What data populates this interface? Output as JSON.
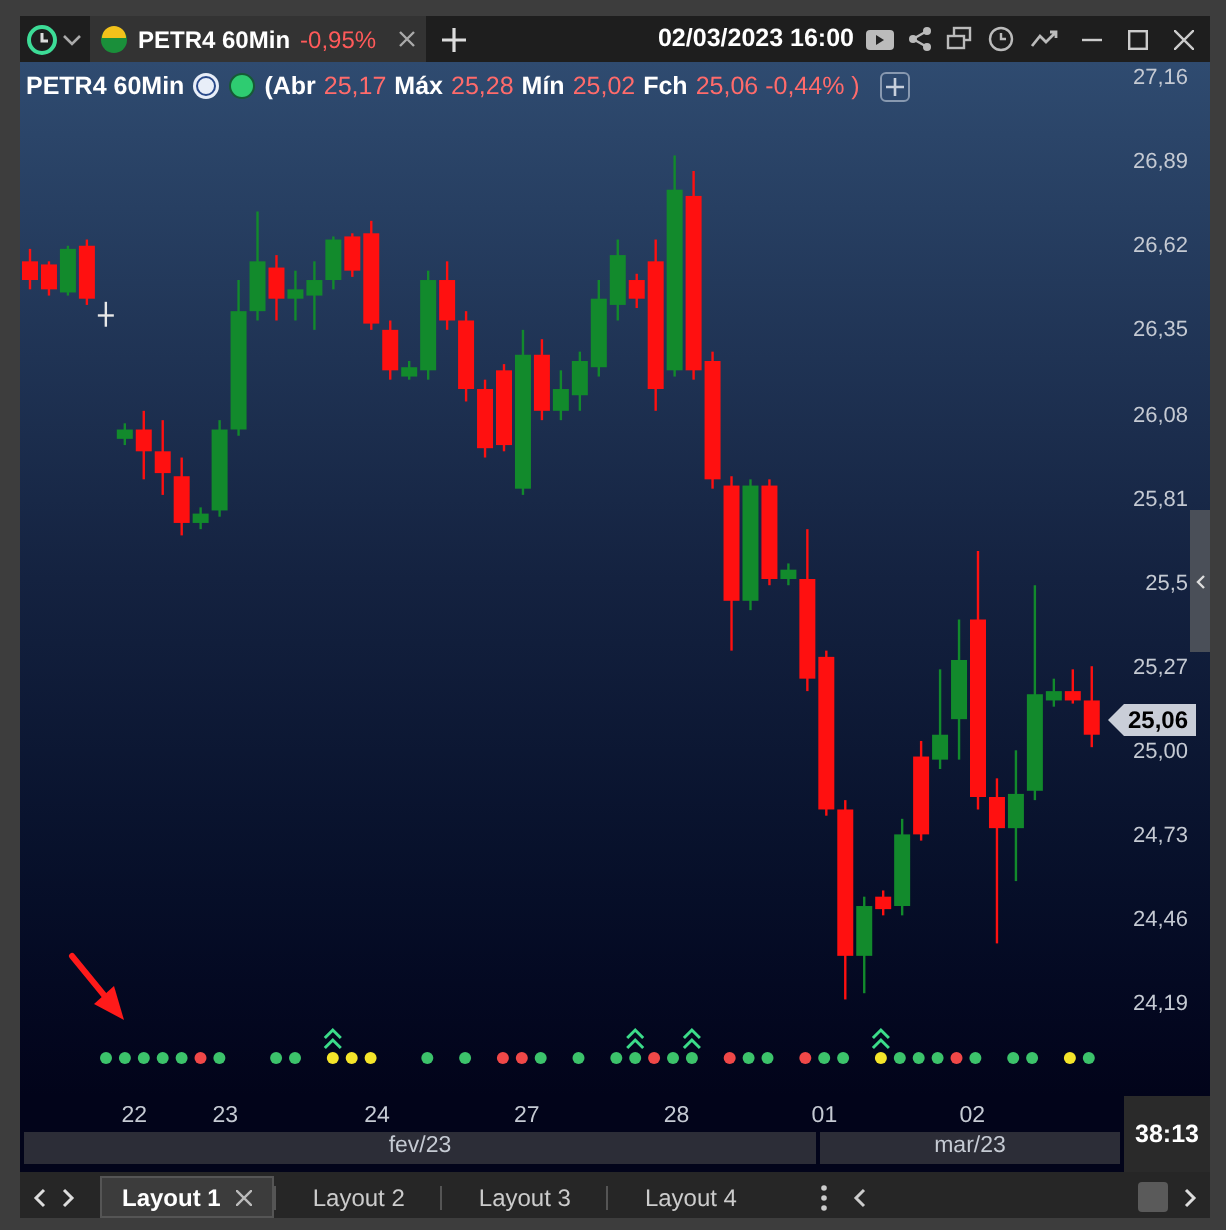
{
  "title_bar": {
    "tab": {
      "symbol": "PETR4 60Min",
      "change": "-0,95%"
    },
    "datetime": "02/03/2023 16:00"
  },
  "header": {
    "symbol": "PETR4 60Min",
    "fields": [
      {
        "label": "(Abr",
        "value": "25,17"
      },
      {
        "label": "Máx",
        "value": "25,28"
      },
      {
        "label": "Mín",
        "value": "25,02"
      },
      {
        "label": "Fch",
        "value": "25,06 -0,44% )"
      }
    ]
  },
  "chart": {
    "chart_data": {
      "type": "candlestick",
      "categories": [
        null,
        null,
        null,
        null,
        null,
        null,
        null,
        null,
        null,
        null,
        null,
        null,
        null,
        null,
        null,
        null,
        null,
        null,
        null,
        null,
        null,
        null,
        null,
        null,
        null,
        null,
        null,
        null,
        null,
        null,
        null,
        null,
        null,
        null,
        null,
        null,
        null,
        null,
        null,
        null,
        null,
        null,
        null,
        null,
        null,
        null,
        null,
        null,
        null,
        null,
        null,
        null,
        null,
        null,
        null,
        null,
        null
      ],
      "ohlc": [
        [
          26.58,
          26.62,
          26.49,
          26.52
        ],
        [
          26.57,
          26.58,
          26.47,
          26.49
        ],
        [
          26.48,
          26.63,
          26.47,
          26.62
        ],
        [
          26.63,
          26.65,
          26.44,
          26.46
        ],
        [
          26.41,
          26.45,
          26.37,
          26.41
        ],
        [
          26.01,
          26.06,
          25.99,
          26.04
        ],
        [
          26.04,
          26.1,
          25.88,
          25.97
        ],
        [
          25.97,
          26.07,
          25.83,
          25.9
        ],
        [
          25.89,
          25.95,
          25.7,
          25.74
        ],
        [
          25.74,
          25.79,
          25.72,
          25.77
        ],
        [
          25.78,
          26.07,
          25.76,
          26.04
        ],
        [
          26.04,
          26.52,
          26.02,
          26.42
        ],
        [
          26.42,
          26.74,
          26.39,
          26.58
        ],
        [
          26.56,
          26.6,
          26.39,
          26.46
        ],
        [
          26.46,
          26.55,
          26.39,
          26.49
        ],
        [
          26.47,
          26.58,
          26.36,
          26.52
        ],
        [
          26.52,
          26.66,
          26.49,
          26.65
        ],
        [
          26.66,
          26.67,
          26.53,
          26.55
        ],
        [
          26.67,
          26.71,
          26.36,
          26.38
        ],
        [
          26.36,
          26.39,
          26.2,
          26.23
        ],
        [
          26.21,
          26.26,
          26.2,
          26.24
        ],
        [
          26.23,
          26.55,
          26.2,
          26.52
        ],
        [
          26.52,
          26.58,
          26.36,
          26.39
        ],
        [
          26.39,
          26.42,
          26.13,
          26.17
        ],
        [
          26.17,
          26.2,
          25.95,
          25.98
        ],
        [
          26.23,
          26.25,
          25.97,
          25.99
        ],
        [
          25.85,
          26.36,
          25.83,
          26.28
        ],
        [
          26.28,
          26.33,
          26.07,
          26.1
        ],
        [
          26.1,
          26.23,
          26.07,
          26.17
        ],
        [
          26.15,
          26.29,
          26.1,
          26.26
        ],
        [
          26.24,
          26.52,
          26.21,
          26.46
        ],
        [
          26.44,
          26.65,
          26.39,
          26.6
        ],
        [
          26.52,
          26.54,
          26.43,
          26.46
        ],
        [
          26.58,
          26.65,
          26.1,
          26.17
        ],
        [
          26.23,
          26.92,
          26.21,
          26.81
        ],
        [
          26.79,
          26.87,
          26.2,
          26.23
        ],
        [
          26.26,
          26.29,
          25.85,
          25.88
        ],
        [
          25.86,
          25.89,
          25.33,
          25.49
        ],
        [
          25.49,
          25.88,
          25.46,
          25.86
        ],
        [
          25.86,
          25.88,
          25.54,
          25.56
        ],
        [
          25.56,
          25.61,
          25.54,
          25.59
        ],
        [
          25.56,
          25.72,
          25.2,
          25.24
        ],
        [
          25.31,
          25.33,
          24.8,
          24.82
        ],
        [
          24.82,
          24.85,
          24.21,
          24.35
        ],
        [
          24.35,
          24.54,
          24.23,
          24.51
        ],
        [
          24.54,
          24.56,
          24.48,
          24.5
        ],
        [
          24.51,
          24.79,
          24.48,
          24.74
        ],
        [
          24.99,
          25.04,
          24.72,
          24.74
        ],
        [
          24.98,
          25.27,
          24.95,
          25.06
        ],
        [
          25.11,
          25.43,
          24.98,
          25.3
        ],
        [
          25.43,
          25.65,
          24.82,
          24.86
        ],
        [
          24.86,
          24.92,
          24.39,
          24.76
        ],
        [
          24.76,
          25.01,
          24.59,
          24.87
        ],
        [
          24.88,
          25.54,
          24.85,
          25.19
        ],
        [
          25.17,
          25.24,
          25.15,
          25.2
        ],
        [
          25.2,
          25.27,
          25.16,
          25.17
        ],
        [
          25.17,
          25.28,
          25.02,
          25.06
        ]
      ],
      "yticks": [
        {
          "value": 27.16,
          "label": "27,16"
        },
        {
          "value": 26.89,
          "label": "26,89"
        },
        {
          "value": 26.62,
          "label": "26,62"
        },
        {
          "value": 26.35,
          "label": "26,35"
        },
        {
          "value": 26.08,
          "label": "26,08"
        },
        {
          "value": 25.81,
          "label": "25,81"
        },
        {
          "value": 25.54,
          "label": "25,5"
        },
        {
          "value": 25.27,
          "label": "25,27"
        },
        {
          "value": 25.0,
          "label": "25,00"
        },
        {
          "value": 24.73,
          "label": "24,73"
        },
        {
          "value": 24.46,
          "label": "24,46"
        },
        {
          "value": 24.19,
          "label": "24,19"
        }
      ],
      "ylim": [
        23.9,
        27.22
      ]
    },
    "current_price": "25,06"
  },
  "signals": [
    {
      "kind": "dot",
      "color": "#3cc36b",
      "arrow": false
    },
    {
      "kind": "dot",
      "color": "#3cc36b",
      "arrow": false
    },
    {
      "kind": "dot",
      "color": "#3cc36b",
      "arrow": false
    },
    {
      "kind": "dot",
      "color": "#3cc36b",
      "arrow": false
    },
    {
      "kind": "dot",
      "color": "#3cc36b",
      "arrow": false
    },
    {
      "kind": "dot",
      "color": "#f04848",
      "arrow": false
    },
    {
      "kind": "dot",
      "color": "#3cc36b",
      "arrow": false
    },
    {
      "kind": "empty"
    },
    {
      "kind": "empty"
    },
    {
      "kind": "dot",
      "color": "#3cc36b",
      "arrow": false
    },
    {
      "kind": "dot",
      "color": "#3cc36b",
      "arrow": false
    },
    {
      "kind": "empty"
    },
    {
      "kind": "dot",
      "color": "#f5e52a",
      "arrow": true
    },
    {
      "kind": "dot",
      "color": "#f5e52a",
      "arrow": false
    },
    {
      "kind": "dot",
      "color": "#f5e52a",
      "arrow": false
    },
    {
      "kind": "empty"
    },
    {
      "kind": "empty"
    },
    {
      "kind": "dot",
      "color": "#3cc36b",
      "arrow": false
    },
    {
      "kind": "empty"
    },
    {
      "kind": "dot",
      "color": "#3cc36b",
      "arrow": false
    },
    {
      "kind": "empty"
    },
    {
      "kind": "dot",
      "color": "#f04848",
      "arrow": false
    },
    {
      "kind": "dot",
      "color": "#f04848",
      "arrow": false
    },
    {
      "kind": "dot",
      "color": "#3cc36b",
      "arrow": false
    },
    {
      "kind": "empty"
    },
    {
      "kind": "dot",
      "color": "#3cc36b",
      "arrow": false
    },
    {
      "kind": "empty"
    },
    {
      "kind": "dot",
      "color": "#3cc36b",
      "arrow": false
    },
    {
      "kind": "dot",
      "color": "#3cc36b",
      "arrow": true
    },
    {
      "kind": "dot",
      "color": "#f04848",
      "arrow": false
    },
    {
      "kind": "dot",
      "color": "#3cc36b",
      "arrow": false
    },
    {
      "kind": "dot",
      "color": "#3cc36b",
      "arrow": true
    },
    {
      "kind": "empty"
    },
    {
      "kind": "dot",
      "color": "#f04848",
      "arrow": false
    },
    {
      "kind": "dot",
      "color": "#3cc36b",
      "arrow": false
    },
    {
      "kind": "dot",
      "color": "#3cc36b",
      "arrow": false
    },
    {
      "kind": "empty"
    },
    {
      "kind": "dot",
      "color": "#f04848",
      "arrow": false
    },
    {
      "kind": "dot",
      "color": "#3cc36b",
      "arrow": false
    },
    {
      "kind": "dot",
      "color": "#3cc36b",
      "arrow": false
    },
    {
      "kind": "empty"
    },
    {
      "kind": "dot",
      "color": "#f5e52a",
      "arrow": true
    },
    {
      "kind": "dot",
      "color": "#3cc36b",
      "arrow": false
    },
    {
      "kind": "dot",
      "color": "#3cc36b",
      "arrow": false
    },
    {
      "kind": "dot",
      "color": "#3cc36b",
      "arrow": false
    },
    {
      "kind": "dot",
      "color": "#f04848",
      "arrow": false
    },
    {
      "kind": "dot",
      "color": "#3cc36b",
      "arrow": false
    },
    {
      "kind": "empty"
    },
    {
      "kind": "dot",
      "color": "#3cc36b",
      "arrow": false
    },
    {
      "kind": "dot",
      "color": "#3cc36b",
      "arrow": false
    },
    {
      "kind": "empty"
    },
    {
      "kind": "dot",
      "color": "#f5e52a",
      "arrow": false
    },
    {
      "kind": "dot",
      "color": "#3cc36b",
      "arrow": false
    }
  ],
  "date_axis": {
    "labels": [
      "22",
      "23",
      "24",
      "27",
      "28",
      "01",
      "02"
    ],
    "months": [
      "fev/23",
      "mar/23"
    ]
  },
  "timer": "38:13",
  "layout_tabs": [
    {
      "label": "Layout 1",
      "selected": true
    },
    {
      "label": "Layout 2",
      "selected": false
    },
    {
      "label": "Layout 3",
      "selected": false
    },
    {
      "label": "Layout 4",
      "selected": false
    }
  ]
}
